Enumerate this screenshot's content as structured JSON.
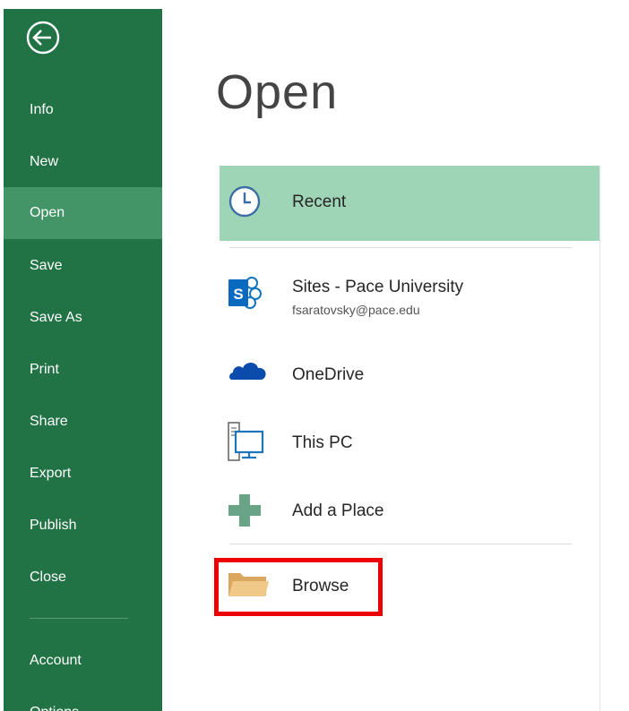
{
  "sidebar": {
    "items": [
      {
        "label": "Info"
      },
      {
        "label": "New"
      },
      {
        "label": "Open"
      },
      {
        "label": "Save"
      },
      {
        "label": "Save As"
      },
      {
        "label": "Print"
      },
      {
        "label": "Share"
      },
      {
        "label": "Export"
      },
      {
        "label": "Publish"
      },
      {
        "label": "Close"
      }
    ],
    "lower_items": [
      {
        "label": "Account"
      },
      {
        "label": "Options"
      }
    ],
    "selected": "Open",
    "color": "#217346",
    "selected_color": "#439467"
  },
  "main": {
    "title": "Open",
    "locations": [
      {
        "label": "Recent",
        "icon": "clock-icon",
        "selected": true
      },
      {
        "label": "Sites - Pace University",
        "sublabel": "fsaratovsky@pace.edu",
        "icon": "sharepoint-icon"
      },
      {
        "label": "OneDrive",
        "icon": "onedrive-cloud-icon"
      },
      {
        "label": "This PC",
        "icon": "computer-icon"
      },
      {
        "label": "Add a Place",
        "icon": "plus-icon"
      },
      {
        "label": "Browse",
        "icon": "folder-icon",
        "highlighted": true
      }
    ],
    "recent_highlight_color": "#9fd5b7",
    "annotation_color": "#ee0000"
  }
}
